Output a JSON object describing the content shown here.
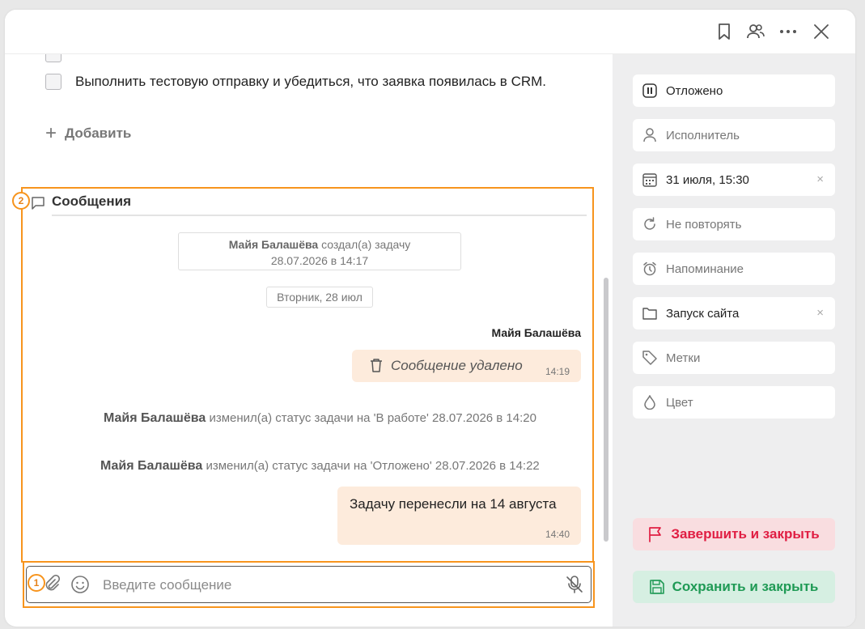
{
  "colors": {
    "accent_orange": "#f7941d",
    "finish_bg": "#f9dde0",
    "finish_text": "#e01e43",
    "save_bg": "#d6efe2",
    "save_text": "#1f9a55",
    "bubble_bg": "#fdebdc"
  },
  "header": {
    "icons": [
      "bookmark-icon",
      "users-icon",
      "more-icon",
      "close-icon"
    ]
  },
  "checklist": {
    "items": [
      {
        "text": "Выполнить тестовую отправку и убедиться, что заявка появилась в CRM.",
        "checked": false
      }
    ],
    "add_label": "Добавить"
  },
  "messages": {
    "title": "Сообщения",
    "created": {
      "author": "Майя Балашёва",
      "action": "создал(а) задачу",
      "datetime": "28.07.2026 в 14:17"
    },
    "date_separator": "Вторник, 28 июл",
    "deleted_message": {
      "author": "Майя Балашёва",
      "text": "Сообщение удалено",
      "time": "14:19"
    },
    "status_changes": [
      {
        "author": "Майя Балашёва",
        "text": "изменил(а) статус задачи на 'В работе' 28.07.2026 в 14:20"
      },
      {
        "author": "Майя Балашёва",
        "text": "изменил(а) статус задачи на 'Отложено' 28.07.2026 в 14:22"
      }
    ],
    "last_message": {
      "text": "Задачу перенесли на 14 августа",
      "time": "14:40"
    }
  },
  "composer": {
    "placeholder": "Введите сообщение"
  },
  "annotations": {
    "badge_1": "1",
    "badge_2": "2"
  },
  "sidebar": {
    "status": "Отложено",
    "assignee": "Исполнитель",
    "due_date": "31 июля, 15:30",
    "repeat": "Не повторять",
    "reminder": "Напоминание",
    "project": "Запуск сайта",
    "tags": "Метки",
    "color": "Цвет",
    "clear_symbol": "×",
    "finish_button": "Завершить и закрыть",
    "save_button": "Сохранить и закрыть"
  }
}
